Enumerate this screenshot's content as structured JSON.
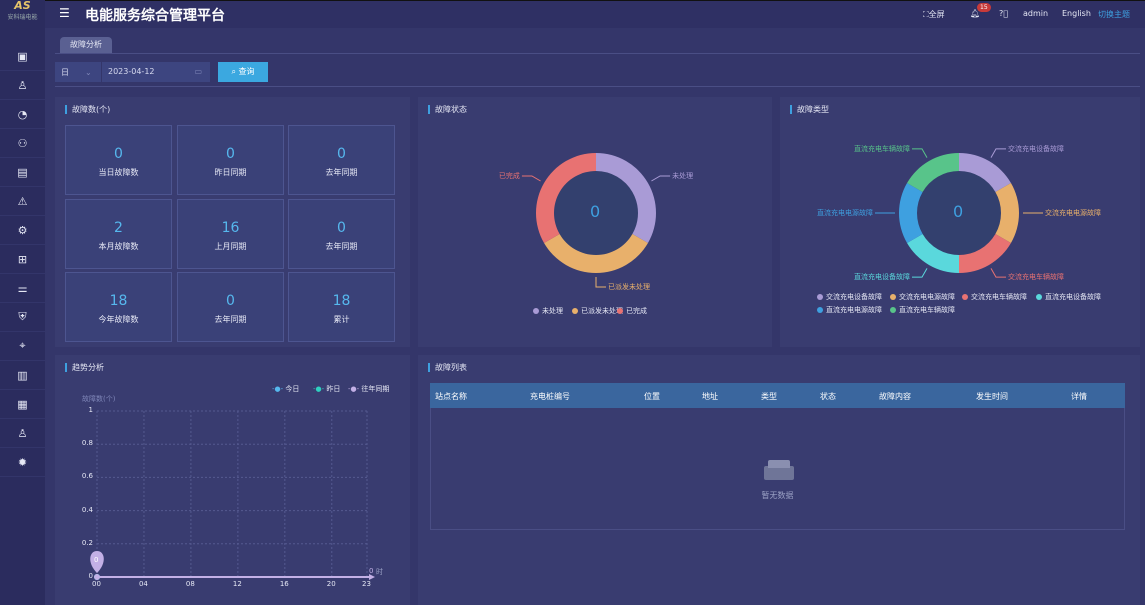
{
  "logo": {
    "mark": "AS",
    "text": "安科瑞电能"
  },
  "header": {
    "title": "电能服务综合管理平台",
    "fullscreen": "全屏",
    "notifications": "15",
    "user": "admin",
    "language": "English",
    "theme": "切换主题"
  },
  "sidebar": {
    "icons": [
      "monitor-icon",
      "topology-icon",
      "pie-chart-icon",
      "users-icon",
      "document-icon",
      "warning-icon",
      "station-icon",
      "gift-icon",
      "sliders-icon",
      "shield-icon",
      "network-icon",
      "meter-icon",
      "storage-icon",
      "org-icon",
      "gear-icon"
    ]
  },
  "tabs": [
    {
      "label": "故障分析"
    }
  ],
  "filter": {
    "period": "日",
    "date": "2023-04-12",
    "query": "查询"
  },
  "fault_count": {
    "title": "故障数(个)",
    "cells": [
      {
        "value": "0",
        "label": "当日故障数"
      },
      {
        "value": "0",
        "label": "昨日同期"
      },
      {
        "value": "0",
        "label": "去年同期"
      },
      {
        "value": "2",
        "label": "本月故障数"
      },
      {
        "value": "16",
        "label": "上月同期"
      },
      {
        "value": "0",
        "label": "去年同期"
      },
      {
        "value": "18",
        "label": "今年故障数"
      },
      {
        "value": "0",
        "label": "去年同期"
      },
      {
        "value": "18",
        "label": "累计"
      }
    ]
  },
  "chart_data": [
    {
      "type": "pie",
      "title": "故障状态",
      "center_label": "0",
      "categories": [
        "未处理",
        "已派发未处理",
        "已完成"
      ],
      "values": [
        0,
        0,
        0
      ],
      "colors": [
        "#a99bd6",
        "#e8b06b",
        "#e87272"
      ]
    },
    {
      "type": "pie",
      "title": "故障类型",
      "center_label": "0",
      "categories": [
        "交流充电设备故障",
        "交流充电电源故障",
        "交流充电车辆故障",
        "直流充电设备故障",
        "直流充电电源故障",
        "直流充电车辆故障"
      ],
      "values": [
        0,
        0,
        0,
        0,
        0,
        0
      ],
      "colors": [
        "#a99bd6",
        "#e8b06b",
        "#e87272",
        "#5ad8dc",
        "#3ea0e0",
        "#58c48a"
      ]
    },
    {
      "type": "line",
      "title": "趋势分析",
      "ylabel": "故障数(个)",
      "xlabel": "时",
      "ylim": [
        0,
        1
      ],
      "yticks": [
        "0",
        "0.2",
        "0.4",
        "0.6",
        "0.8",
        "1"
      ],
      "xticks": [
        "00",
        "04",
        "08",
        "12",
        "16",
        "20",
        "23"
      ],
      "grid": true,
      "legend": "top-right",
      "series": [
        {
          "name": "今日",
          "color": "#56b8ee",
          "values": [
            0
          ]
        },
        {
          "name": "昨日",
          "color": "#2fd0c0",
          "values": [
            0
          ]
        },
        {
          "name": "往年同期",
          "color": "#c3b0e6",
          "values": [
            0
          ]
        }
      ],
      "marker_label": "0",
      "end_label": "0"
    }
  ],
  "fault_list": {
    "title": "故障列表",
    "columns": [
      "站点名称",
      "充电桩编号",
      "位置",
      "地址",
      "类型",
      "状态",
      "故障内容",
      "发生时间",
      "详情"
    ],
    "empty": "暂无数据"
  }
}
